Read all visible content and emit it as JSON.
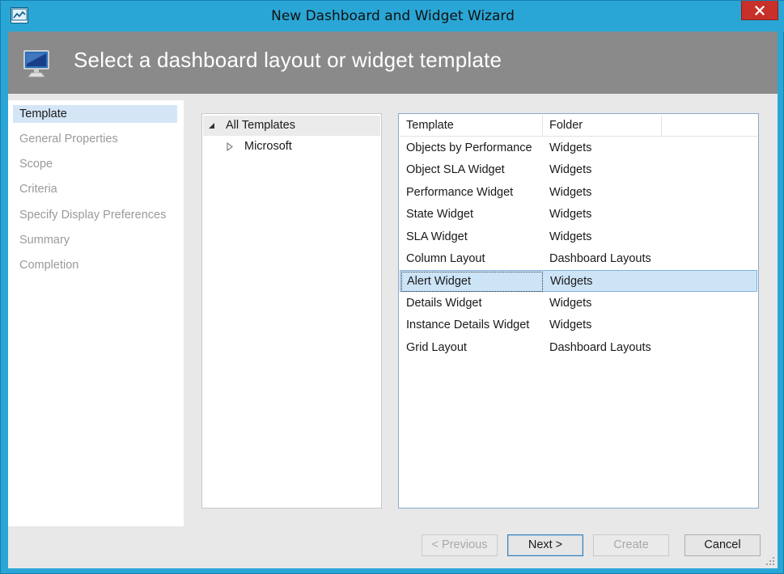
{
  "window": {
    "title": "New Dashboard and Widget Wizard",
    "icon": "monitor-chart-icon",
    "close_icon": "close-icon",
    "frame_color": "#2aa6d6",
    "close_color": "#c7312a"
  },
  "header": {
    "title": "Select a dashboard layout or widget template",
    "icon": "computer-monitor-icon",
    "band_color": "#8a8a8a"
  },
  "nav": {
    "items": [
      {
        "label": "Template",
        "active": true
      },
      {
        "label": "General Properties",
        "active": false
      },
      {
        "label": "Scope",
        "active": false
      },
      {
        "label": "Criteria",
        "active": false
      },
      {
        "label": "Specify Display Preferences",
        "active": false
      },
      {
        "label": "Summary",
        "active": false
      },
      {
        "label": "Completion",
        "active": false
      }
    ]
  },
  "tree": {
    "items": [
      {
        "label": "All Templates",
        "expanded": true,
        "selected": true
      },
      {
        "label": "Microsoft",
        "expanded": false,
        "selected": false
      }
    ]
  },
  "list": {
    "columns": [
      "Template",
      "Folder"
    ],
    "rows": [
      {
        "template": "Objects by Performance",
        "folder": "Widgets"
      },
      {
        "template": "Object SLA Widget",
        "folder": "Widgets"
      },
      {
        "template": "Performance Widget",
        "folder": "Widgets"
      },
      {
        "template": "State Widget",
        "folder": "Widgets"
      },
      {
        "template": "SLA Widget",
        "folder": "Widgets"
      },
      {
        "template": "Column Layout",
        "folder": "Dashboard Layouts"
      },
      {
        "template": "Alert Widget",
        "folder": "Widgets",
        "selected": true
      },
      {
        "template": "Details Widget",
        "folder": "Widgets"
      },
      {
        "template": "Instance Details Widget",
        "folder": "Widgets"
      },
      {
        "template": "Grid Layout",
        "folder": "Dashboard Layouts"
      }
    ],
    "selected_color": "#cde4f7"
  },
  "buttons": {
    "previous": "< Previous",
    "next": "Next >",
    "create": "Create",
    "cancel": "Cancel"
  }
}
